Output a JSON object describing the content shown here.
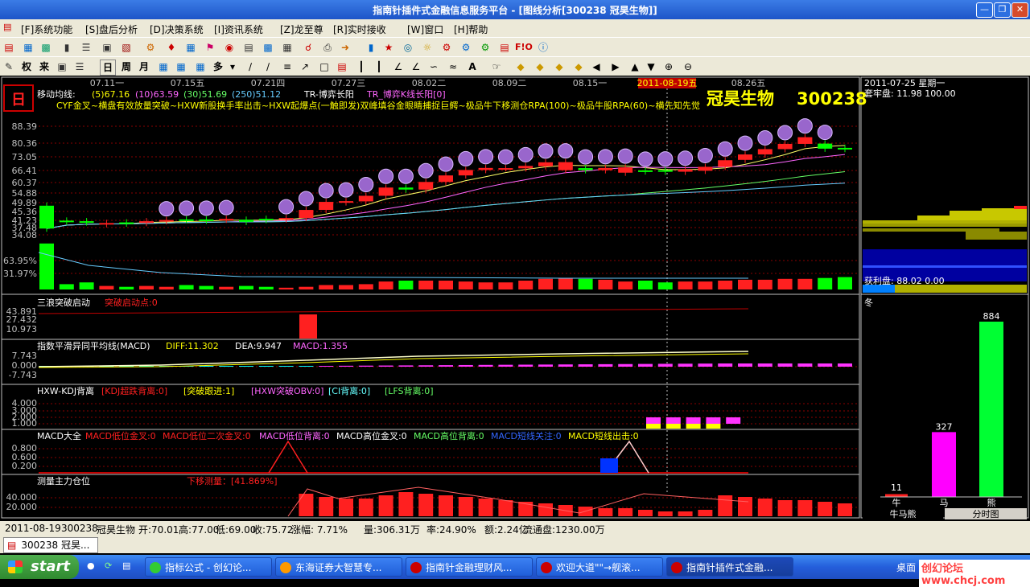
{
  "window": {
    "title": "指南针插件式金融信息服务平台 - [图线分析[300238 冠昊生物]]"
  },
  "menu": [
    "[F]系统功能",
    "[S]盘后分析",
    "[D]决策系统",
    "[I]资讯系统",
    "[Z]龙至尊",
    "[R]实时接收",
    "[W]窗口",
    "[H]帮助"
  ],
  "toolbar2": {
    "quan": "权",
    "lai": "来",
    "ri": "日",
    "zhou": "周",
    "yue": "月",
    "duo": "多"
  },
  "main": {
    "period_badge": "日",
    "dates": [
      "07.11一",
      "07.15五",
      "07.21四",
      "07.27三",
      "08.02二",
      "08.09二",
      "08.15一",
      "08.26五"
    ],
    "date_highlight": "2011-08-19五",
    "ma_label": "移动均线:",
    "ma5": "(5)67.16",
    "ma10": "(10)63.59",
    "ma30": "(30)51.69",
    "ma250": "(250)51.12",
    "tr_label": "TR-博弈长阳",
    "tr_value": "TR_博弈K线长阳[0]",
    "signals": "CYF金叉~横盘有效放量突破~HXW新股换手率出击~HXW起爆点(一触即发)双峰填谷金眼睛捕捉巨鳄~极品牛下移测仓RPA(100)~极品牛股RPA(60)~横先知先觉",
    "stock_name": "冠昊生物",
    "stock_code": "300238",
    "price_axis": [
      "88.39",
      "80.36",
      "73.05",
      "66.41",
      "60.37",
      "54.88",
      "49.89",
      "45.36",
      "41.23",
      "37.48",
      "34.08"
    ],
    "turnover_axis": [
      "63.95%",
      "31.97%"
    ],
    "sub1": {
      "label": "三浪突破启动",
      "value": "突破启动点:0",
      "axis": [
        "43.891",
        "27.432",
        "10.973"
      ]
    },
    "sub2": {
      "label": "指数平滑异同平均线(MACD)",
      "diff": "DIFF:11.302",
      "dea": "DEA:9.947",
      "macd": "MACD:1.355",
      "axis": [
        "7.743",
        "0.000",
        "-7.743"
      ]
    },
    "sub3": {
      "label": "HXW-KDJ背离",
      "kdj": "[KDJ超跌背离:0]",
      "tp": "[突破跟进:1]",
      "obv": "[HXW突破OBV:0]",
      "ci": "[CI背离:0]",
      "lfs": "[LFS背离:0]",
      "axis": [
        "4.000",
        "3.000",
        "2.000",
        "1.000"
      ]
    },
    "sub4": {
      "label": "MACD大全",
      "m1": "MACD低位金叉:0",
      "m2": "MACD低位二次金叉:0",
      "m3": "MACD低位背离:0",
      "m4": "MACD高位金叉:0",
      "m5": "MACD高位背离:0",
      "m6": "MACD短线关注:0",
      "m7": "MACD短线出击:0",
      "axis": [
        "0.800",
        "0.600",
        "0.200"
      ]
    },
    "sub5": {
      "label": "测量主力仓位",
      "value": "下移测量：[41.869%]",
      "axis": [
        "40.000",
        "20.000"
      ]
    }
  },
  "right": {
    "date": "2011-07-25 星期一",
    "trap": "套牢盘: 11.98 100.00",
    "profit": "获利盘: 88.02 0.00",
    "season": "冬",
    "bars": [
      {
        "name": "牛",
        "value": 11
      },
      {
        "name": "马",
        "value": 327
      },
      {
        "name": "熊",
        "value": 884
      }
    ],
    "tab1": "牛马熊",
    "tab2": "分时图"
  },
  "status": {
    "date": "2011-08-19",
    "code": "300238",
    "name": "冠昊生物",
    "open": "开:70.01",
    "high": "高:77.00",
    "low": "低:69.00",
    "close": "收:75.72",
    "chg": "涨幅: 7.71%",
    "vol": "量:306.31万",
    "rate": "率:24.90%",
    "amt": "额:2.24亿",
    "float": "流通盘:1230.00万"
  },
  "window_tab": "300238 冠昊...",
  "taskbar": {
    "start": "start",
    "tasks": [
      "指标公式 - 创幻论...",
      "东海证券大智慧专...",
      "指南针金融理财风...",
      "欢迎大道\"\"→舰滚...",
      "指南针插件式金融..."
    ],
    "desktop": "桌面",
    "watermark": "创幻论坛 www.chcj.com"
  },
  "chart_data": {
    "type": "candlestick",
    "candles": [
      [
        44.0,
        36.0
      ],
      [
        38.6,
        38.2
      ],
      [
        38.4,
        38.0
      ],
      [
        37.4,
        37.8
      ],
      [
        38.0,
        37.6
      ],
      [
        37.8,
        38.4
      ],
      [
        38.4,
        38.8
      ],
      [
        39.0,
        38.8
      ],
      [
        39.0,
        38.6
      ],
      [
        38.9,
        39.2
      ],
      [
        38.9,
        38.2
      ],
      [
        39.2,
        38.8
      ],
      [
        39.0,
        39.5
      ],
      [
        39.5,
        42.4
      ],
      [
        42.4,
        45.5
      ],
      [
        45.3,
        45.8
      ],
      [
        45.7,
        48.0
      ],
      [
        48.0,
        51.6
      ],
      [
        51.6,
        50.7
      ],
      [
        50.7,
        54.2
      ],
      [
        54.2,
        57.4
      ],
      [
        57.4,
        60.2
      ],
      [
        60.2,
        61.3
      ],
      [
        61.2,
        61.2
      ],
      [
        61.1,
        62.4
      ],
      [
        62.2,
        64.4
      ],
      [
        60.1,
        64.5
      ],
      [
        61.2,
        60.1
      ],
      [
        60.1,
        61.3
      ],
      [
        58.8,
        61.6
      ],
      [
        60.0,
        59.5
      ],
      [
        60.1,
        59.3
      ],
      [
        59.3,
        60.5
      ],
      [
        59.8,
        61.9
      ],
      [
        61.9,
        65.6
      ],
      [
        65.8,
        69.0
      ],
      [
        69.0,
        72.3
      ],
      [
        72.3,
        75.7
      ],
      [
        75.7,
        80.3
      ],
      [
        75.9,
        72.6
      ],
      [
        73.1,
        72.4
      ]
    ],
    "volume_pct": [
      52,
      6,
      8,
      4,
      3,
      4,
      3,
      5,
      4,
      3,
      4,
      3,
      2,
      3,
      5,
      5,
      6,
      9,
      10,
      10,
      10,
      9,
      8,
      8,
      10,
      12,
      13,
      12,
      11,
      9,
      10,
      8,
      9,
      9,
      10,
      11,
      11,
      12,
      12,
      13,
      14,
      7
    ],
    "macd_diff": 11.302,
    "macd_dea": 9.947,
    "macd": 1.355,
    "right_bars": [
      11,
      327,
      884
    ]
  }
}
